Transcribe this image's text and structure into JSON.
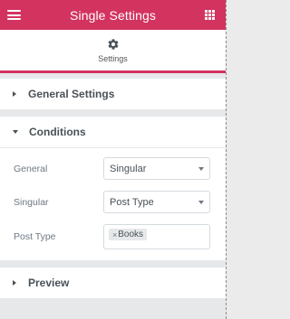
{
  "header": {
    "title": "Single Settings",
    "menu_icon": "hamburger-icon",
    "apps_icon": "grid-icon",
    "accent_color": "#d3335f"
  },
  "tab": {
    "label": "Settings",
    "icon": "gear-icon"
  },
  "sections": {
    "general_settings": {
      "label": "General Settings",
      "expanded": false
    },
    "conditions": {
      "label": "Conditions",
      "expanded": true,
      "fields": {
        "general": {
          "label": "General",
          "value": "Singular"
        },
        "singular": {
          "label": "Singular",
          "value": "Post Type"
        },
        "post_type": {
          "label": "Post Type",
          "tag_remove": "×",
          "tag_value": "Books"
        }
      }
    },
    "preview": {
      "label": "Preview",
      "expanded": false
    }
  }
}
